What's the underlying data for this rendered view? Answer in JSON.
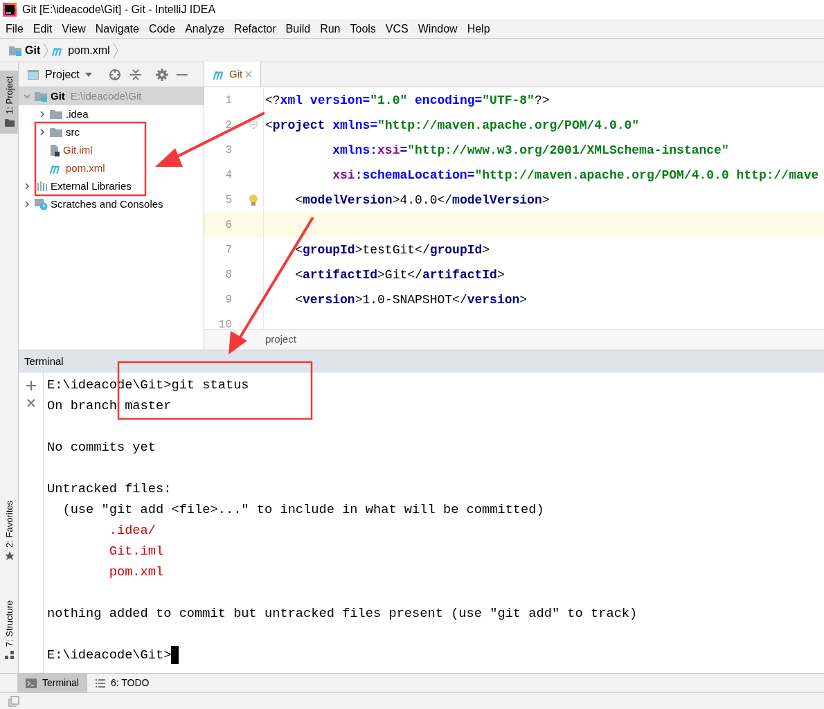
{
  "window": {
    "title": "Git [E:\\ideacode\\Git] - Git - IntelliJ IDEA"
  },
  "menu": [
    "File",
    "Edit",
    "View",
    "Navigate",
    "Code",
    "Analyze",
    "Refactor",
    "Build",
    "Run",
    "Tools",
    "VCS",
    "Window",
    "Help"
  ],
  "breadcrumb": [
    {
      "label": "Git",
      "kind": "module"
    },
    {
      "label": "pom.xml",
      "kind": "maven"
    }
  ],
  "left_tabs": [
    {
      "label": "1: Project",
      "selected": true,
      "kind": "project"
    },
    {
      "label": "2: Favorites",
      "selected": false,
      "kind": "favorites"
    },
    {
      "label": "7: Structure",
      "selected": false,
      "kind": "structure"
    }
  ],
  "project_panel": {
    "title": "Project",
    "tree": [
      {
        "label": "Git",
        "path": "E:\\ideacode\\Git",
        "kind": "module",
        "expanded": true,
        "selected": true,
        "untracked": false,
        "children": [
          {
            "label": ".idea",
            "kind": "folder",
            "expanded": false,
            "selected": false,
            "untracked": false
          },
          {
            "label": "src",
            "kind": "folder",
            "expanded": false,
            "selected": false,
            "untracked": false
          },
          {
            "label": "Git.iml",
            "kind": "iml",
            "selected": false,
            "untracked": true
          },
          {
            "label": "pom.xml",
            "kind": "maven",
            "selected": false,
            "untracked": true
          }
        ]
      },
      {
        "label": "External Libraries",
        "kind": "libraries",
        "expanded": false,
        "selected": false,
        "untracked": false
      },
      {
        "label": "Scratches and Consoles",
        "kind": "scratches",
        "expanded": false,
        "selected": false,
        "untracked": false
      }
    ]
  },
  "editor": {
    "tabs": [
      {
        "label": "Git",
        "selected": true
      }
    ],
    "lines": [
      {
        "number": "1",
        "current": false,
        "tokens": [
          {
            "text": "<?",
            "kind": "punct"
          },
          {
            "text": "xml ",
            "kind": "attr"
          },
          {
            "text": "version=",
            "kind": "attr"
          },
          {
            "text": "\"1.0\"",
            "kind": "str"
          },
          {
            "text": " encoding=",
            "kind": "attr"
          },
          {
            "text": "\"UTF-8\"",
            "kind": "str"
          },
          {
            "text": "?>",
            "kind": "punct"
          }
        ]
      },
      {
        "number": "2",
        "current": false,
        "tokens": [
          {
            "text": "<",
            "kind": "punct"
          },
          {
            "text": "project",
            "kind": "tag"
          },
          {
            "text": " xmlns=",
            "kind": "attr"
          },
          {
            "text": "\"http://maven.apache.org/POM/4.0.0\"",
            "kind": "str"
          }
        ]
      },
      {
        "number": "3",
        "current": false,
        "tokens": [
          {
            "text": "         xmlns:",
            "kind": "attr"
          },
          {
            "text": "xsi",
            "kind": "ns"
          },
          {
            "text": "=",
            "kind": "attr"
          },
          {
            "text": "\"http://www.w3.org/2001/XMLSchema-instance\"",
            "kind": "str"
          }
        ]
      },
      {
        "number": "4",
        "current": false,
        "tokens": [
          {
            "text": "         xsi",
            "kind": "ns"
          },
          {
            "text": ":schemaLocation=",
            "kind": "attr"
          },
          {
            "text": "\"http://maven.apache.org/POM/4.0.0 http://mave",
            "kind": "str"
          }
        ]
      },
      {
        "number": "5",
        "current": false,
        "tokens": [
          {
            "text": "    <",
            "kind": "punct"
          },
          {
            "text": "modelVersion",
            "kind": "tag"
          },
          {
            "text": ">",
            "kind": "punct"
          },
          {
            "text": "4.0.0",
            "kind": "text"
          },
          {
            "text": "</",
            "kind": "punct"
          },
          {
            "text": "modelVersion",
            "kind": "tag"
          },
          {
            "text": ">",
            "kind": "punct"
          }
        ]
      },
      {
        "number": "6",
        "current": true
      },
      {
        "number": "7",
        "current": false,
        "tokens": [
          {
            "text": "    <",
            "kind": "punct"
          },
          {
            "text": "groupId",
            "kind": "tag"
          },
          {
            "text": ">",
            "kind": "punct"
          },
          {
            "text": "testGit",
            "kind": "text"
          },
          {
            "text": "</",
            "kind": "punct"
          },
          {
            "text": "groupId",
            "kind": "tag"
          },
          {
            "text": ">",
            "kind": "punct"
          }
        ]
      },
      {
        "number": "8",
        "current": false,
        "tokens": [
          {
            "text": "    <",
            "kind": "punct"
          },
          {
            "text": "artifactId",
            "kind": "tag"
          },
          {
            "text": ">",
            "kind": "punct"
          },
          {
            "text": "Git",
            "kind": "text"
          },
          {
            "text": "</",
            "kind": "punct"
          },
          {
            "text": "artifactId",
            "kind": "tag"
          },
          {
            "text": ">",
            "kind": "punct"
          }
        ]
      },
      {
        "number": "9",
        "current": false,
        "tokens": [
          {
            "text": "    <",
            "kind": "punct"
          },
          {
            "text": "version",
            "kind": "tag"
          },
          {
            "text": ">",
            "kind": "punct"
          },
          {
            "text": "1.0-SNAPSHOT",
            "kind": "text"
          },
          {
            "text": "</",
            "kind": "punct"
          },
          {
            "text": "version",
            "kind": "tag"
          },
          {
            "text": ">",
            "kind": "punct"
          }
        ]
      },
      {
        "number": "10",
        "current": false
      }
    ],
    "breadcrumb": "project"
  },
  "terminal": {
    "title": "Terminal",
    "lines": [
      {
        "text": "E:\\ideacode\\Git>git status",
        "kind": "normal"
      },
      {
        "text": "On branch master",
        "kind": "normal"
      },
      {
        "kind": "blank"
      },
      {
        "text": "No commits yet",
        "kind": "normal"
      },
      {
        "kind": "blank"
      },
      {
        "text": "Untracked files:",
        "kind": "normal"
      },
      {
        "text": "  (use \"git add <file>...\" to include in what will be committed)",
        "kind": "normal"
      },
      {
        "text": "        .idea/",
        "kind": "untracked"
      },
      {
        "text": "        Git.iml",
        "kind": "untracked"
      },
      {
        "text": "        pom.xml",
        "kind": "untracked"
      },
      {
        "kind": "blank"
      },
      {
        "text": "nothing added to commit but untracked files present (use \"git add\" to track)",
        "kind": "normal"
      },
      {
        "kind": "blank"
      },
      {
        "text": "E:\\ideacode\\Git>",
        "kind": "prompt"
      }
    ]
  },
  "bottom_tabs": [
    {
      "label": "Terminal",
      "selected": true,
      "kind": "terminal"
    },
    {
      "label": "6: TODO",
      "selected": false,
      "kind": "todo"
    }
  ]
}
